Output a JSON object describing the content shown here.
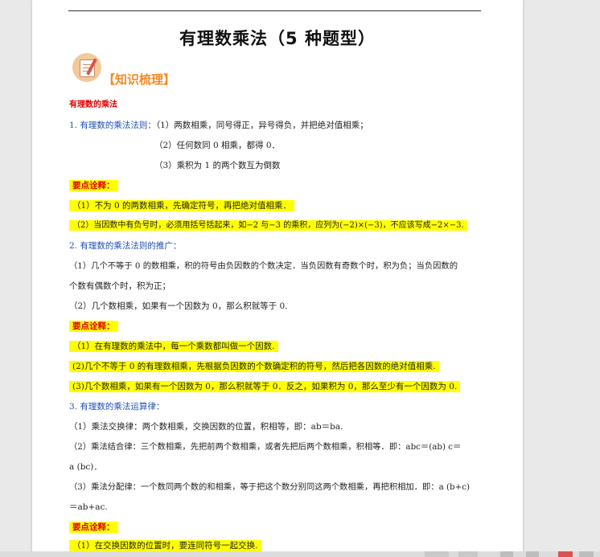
{
  "document": {
    "title": "有理数乘法（5 种题型）",
    "section_heading": "【知识梳理】",
    "topic": "有理数的乘法",
    "rule1": {
      "heading": "1. 有理数的乘法法则：",
      "item1": "（1）两数相乘，同号得正，异号得负，并把绝对值相乘；",
      "item2": "（2）任何数同 0 相乘，都得 0．",
      "item3": "（3）乘积为 1 的两个数互为倒数"
    },
    "notes1": {
      "heading": "要点诠释：",
      "item1": "（1）不为 0 的两数相乘，先确定符号，再把绝对值相乘．",
      "item2": "（2）当因数中有负号时，必须用括号括起来，如−2 与−3 的乘积，应列为(−2)×(−3)，不应该写成−2×−3."
    },
    "rule2": {
      "heading": "2.  有理数的乘法法则的推广：",
      "item1_line1": "（1）几个不等于 0 的数相乘，积的符号由负因数的个数决定．当负因数有奇数个时，积为负；当负因数的",
      "item1_line2": "个数有偶数个时，积为正；",
      "item2": "（2）几个数相乘，如果有一个因数为 0，那么积就等于 0."
    },
    "notes2": {
      "heading": "要点诠释：",
      "item1": "（1）在有理数的乘法中，每一个乘数都叫做一个因数.",
      "item2": "(2)几个不等于 0 的有理数相乘，先根据负因数的个数确定积的符号，然后把各因数的绝对值相乘.",
      "item3": "(3)几个数相乘，如果有一个因数为 0，那么积就等于 0．反之，如果积为 0，那么至少有一个因数为 0."
    },
    "rule3": {
      "heading": "3.  有理数的乘法运算律：",
      "item1": "（1）乘法交换律：两个数相乘，交换因数的位置，积相等，即：ab＝ba.",
      "item2_line1": "（2）乘法结合律：三个数相乘，先把前两个数相乘，或者先把后两个数相乘，积相等．即：abc＝(ab) c＝",
      "item2_line2": "a (bc)．",
      "item3_line1": "（3）乘法分配律：一个数同两个数的和相乘，等于把这个数分别同这两个数相乘，再把积相加．即：a (b+c)",
      "item3_line2": "＝ab+ac."
    },
    "notes3": {
      "heading": "要点诠释：",
      "item1": "（1）在交换因数的位置时，要连同符号一起交换."
    }
  },
  "colors": {
    "highlight": "#ffff00",
    "topic_red": "#e00000",
    "heading_blue": "#1f4fb3",
    "section_orange": "#f28c28"
  }
}
